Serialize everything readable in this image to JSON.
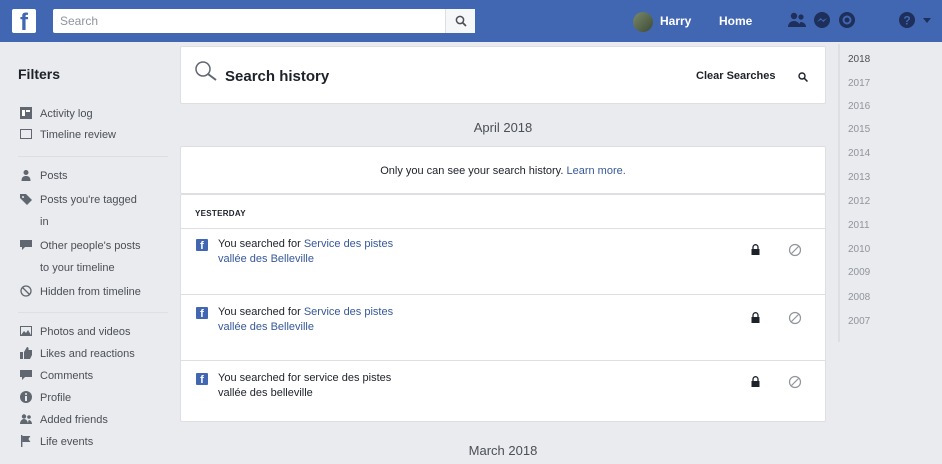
{
  "topbar": {
    "logo": "f",
    "search_placeholder": "Search",
    "user_name": "Harry",
    "home_label": "Home"
  },
  "filters": {
    "title": "Filters",
    "items": [
      {
        "label": "Activity log",
        "icon": "activity-log-icon"
      },
      {
        "label": "Timeline review",
        "icon": "timeline-review-icon"
      },
      {
        "label": "Posts",
        "icon": "person-icon"
      },
      {
        "label_line1": "Posts you're tagged",
        "label_line2": "in",
        "icon": "tag-icon"
      },
      {
        "label_line1": "Other people's posts",
        "label_line2": "to your timeline",
        "icon": "speech-bubble-icon"
      },
      {
        "label": "Hidden from timeline",
        "icon": "hidden-icon"
      },
      {
        "label": "Photos and videos",
        "icon": "photo-icon"
      },
      {
        "label": "Likes and reactions",
        "icon": "like-icon"
      },
      {
        "label": "Comments",
        "icon": "comment-icon"
      },
      {
        "label": "Profile",
        "icon": "info-icon"
      },
      {
        "label": "Added friends",
        "icon": "friends-icon"
      },
      {
        "label": "Life events",
        "icon": "flag-icon"
      }
    ]
  },
  "main": {
    "header_title": "Search history",
    "clear_label": "Clear Searches",
    "month_1": "April 2018",
    "privacy_text": "Only you can see your search history.",
    "learn_more": "Learn more.",
    "day_label": "YESTERDAY",
    "entries": [
      {
        "prefix": "You searched for",
        "query_line1": "Service des pistes",
        "query_line2": "vallée des Belleville",
        "linked": true
      },
      {
        "prefix": "You searched for",
        "query_line1": "Service des pistes",
        "query_line2": "vallée des Belleville",
        "linked": true
      },
      {
        "prefix": "You searched for service des pistes",
        "query_line1": "",
        "query_line2": "vallée des belleville",
        "linked": false
      }
    ],
    "month_2": "March 2018"
  },
  "years": [
    "2018",
    "2017",
    "2016",
    "2015",
    "2014",
    "2013",
    "2012",
    "2011",
    "2010",
    "2009",
    "2008",
    "2007"
  ],
  "colors": {
    "brand": "#4267b2",
    "link": "#365899",
    "background": "#e9ebee"
  }
}
